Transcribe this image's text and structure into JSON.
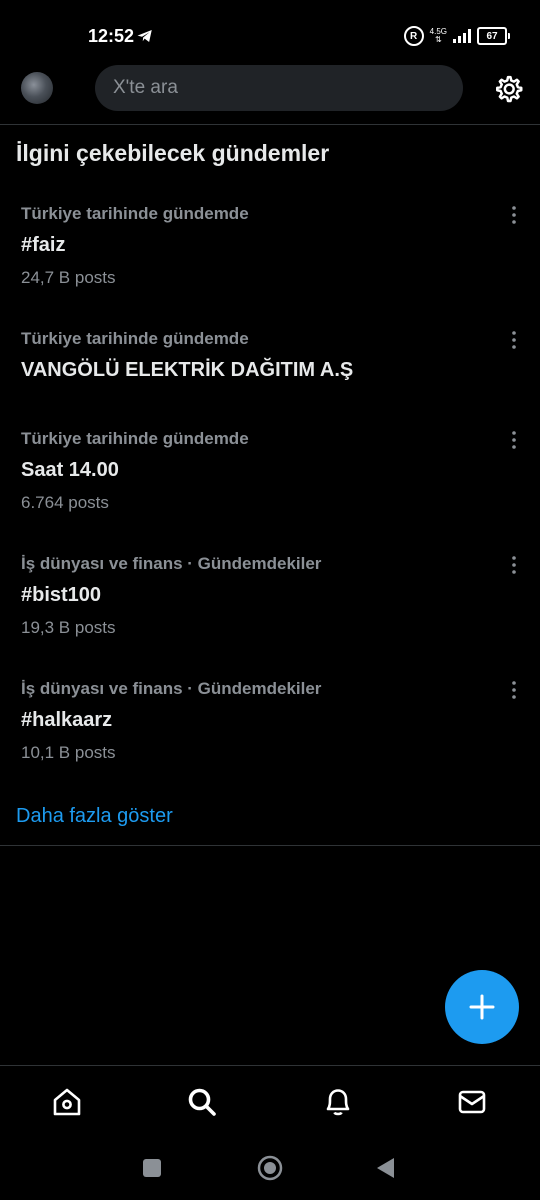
{
  "status_bar": {
    "time": "12:52",
    "network_type": "4.5G",
    "battery": "67"
  },
  "search": {
    "placeholder": "X'te ara"
  },
  "section": {
    "title": "İlgini çekebilecek gündemler"
  },
  "trends": [
    {
      "meta": "Türkiye tarihinde gündemde",
      "name": "#faiz",
      "count": "24,7 B posts"
    },
    {
      "meta": "Türkiye tarihinde gündemde",
      "name": "VANGÖLÜ ELEKTRİK DAĞITIM A.Ş",
      "count": ""
    },
    {
      "meta": "Türkiye tarihinde gündemde",
      "name": "Saat 14.00",
      "count": "6.764 posts"
    },
    {
      "meta": "İş dünyası ve finans · Gündemdekiler",
      "name": "#bist100",
      "count": "19,3 B posts"
    },
    {
      "meta": "İş dünyası ve finans · Gündemdekiler",
      "name": "#halkaarz",
      "count": "10,1 B posts"
    }
  ],
  "show_more": "Daha fazla göster",
  "colors": {
    "background": "#000000",
    "accent": "#1d9bf0",
    "secondary_text": "#8b9096",
    "search_bg": "#202327"
  },
  "icons": {
    "settings": "gear-icon",
    "compose": "plus-icon",
    "nav": [
      "home-icon",
      "search-icon",
      "bell-icon",
      "mail-icon"
    ],
    "system": [
      "square-icon",
      "circle-icon",
      "back-triangle-icon"
    ]
  }
}
